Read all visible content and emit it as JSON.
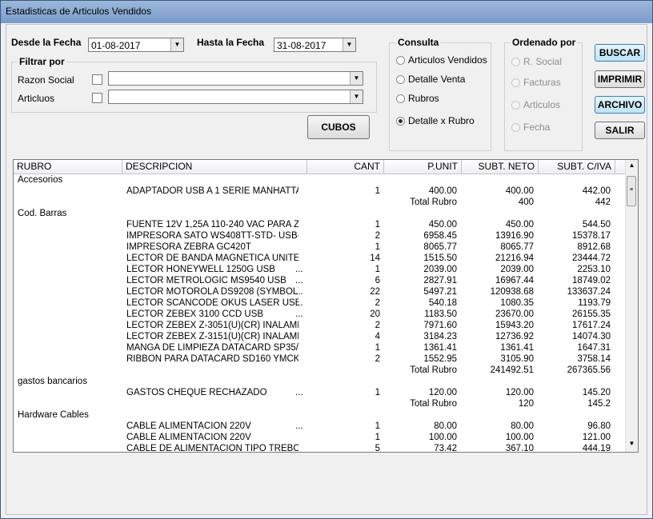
{
  "window": {
    "title": "Estadisticas de Articulos Vendidos"
  },
  "filters": {
    "desde_label": "Desde la Fecha",
    "desde_value": "01-08-2017",
    "hasta_label": "Hasta la Fecha",
    "hasta_value": "31-08-2017",
    "filtrar_por_label": "Filtrar por",
    "razon_social_label": "Razon Social",
    "articulos_label": "Articluos"
  },
  "consulta": {
    "label": "Consulta",
    "options": [
      "Articulos Vendidos",
      "Detalle Venta",
      "Rubros",
      "Detalle x Rubro"
    ],
    "selected": "Detalle x Rubro"
  },
  "ordenado": {
    "label": "Ordenado por",
    "options": [
      "R. Social",
      "Facturas",
      "Articulos",
      "Fecha"
    ]
  },
  "buttons": {
    "buscar": "BUSCAR",
    "imprimir": "IMPRIMIR",
    "archivo": "ARCHIVO",
    "salir": "SALIR",
    "cubos": "CUBOS"
  },
  "table": {
    "headers": [
      "RUBRO",
      "DESCRIPCION",
      "CANT",
      "P.UNIT",
      "SUBT. NETO",
      "SUBT. C/IVA"
    ],
    "rows": [
      [
        "Accesorios",
        "",
        "",
        "",
        "",
        "",
        ""
      ],
      [
        "",
        "ADAPTADOR USB A 1 SERIE MANHATTA...",
        "",
        "1",
        "400.00",
        "400.00",
        "442.00"
      ],
      [
        "",
        "",
        "",
        "",
        "Total Rubro",
        "400",
        "442"
      ],
      [
        "Cod. Barras",
        "",
        "",
        "",
        "",
        "",
        ""
      ],
      [
        "",
        "FUENTE 12V 1,25A 110-240 VAC  PARA Z...",
        "",
        "1",
        "450.00",
        "450.00",
        "544.50"
      ],
      [
        "",
        "IMPRESORA SATO WS408TT-STD- USB- ...",
        "",
        "2",
        "6958.45",
        "13916.90",
        "15378.17"
      ],
      [
        "",
        "IMPRESORA ZEBRA GC420T",
        "",
        "1",
        "8065.77",
        "8065.77",
        "8912.68"
      ],
      [
        "",
        "LECTOR DE BANDA MAGNETICA UNITEC...",
        "",
        "14",
        "1515.50",
        "21216.94",
        "23444.72"
      ],
      [
        "",
        "LECTOR HONEYWELL 1250G USB",
        "...",
        "1",
        "2039.00",
        "2039.00",
        "2253.10"
      ],
      [
        "",
        "LECTOR METROLOGIC MS9540 USB",
        "...",
        "6",
        "2827.91",
        "16967.44",
        "18749.02"
      ],
      [
        "",
        "LECTOR MOTOROLA DS9208  (SYMBOL)",
        "...",
        "22",
        "5497.21",
        "120938.68",
        "133637.24"
      ],
      [
        "",
        "LECTOR SCANCODE OKUS LASER USB",
        "...",
        "2",
        "540.18",
        "1080.35",
        "1193.79"
      ],
      [
        "",
        "LECTOR ZEBEX 3100 CCD USB",
        "...",
        "20",
        "1183.50",
        "23670.00",
        "26155.35"
      ],
      [
        "",
        "LECTOR ZEBEX Z-3051(U)(CR) INALAMBR...",
        "",
        "2",
        "7971.60",
        "15943.20",
        "17617.24"
      ],
      [
        "",
        "LECTOR ZEBEX Z-3151(U)(CR) INALAMBR...",
        "",
        "4",
        "3184.23",
        "12736.92",
        "14074.30"
      ],
      [
        "",
        "MANGA DE LIMPIEZA DATACARD SP35/S...",
        "",
        "1",
        "1361.41",
        "1361.41",
        "1647.31"
      ],
      [
        "",
        "RIBBON PARA DATACARD SD160  YMCK...",
        "",
        "2",
        "1552.95",
        "3105.90",
        "3758.14"
      ],
      [
        "",
        "",
        "",
        "",
        "Total Rubro",
        "241492.51",
        "267365.56"
      ],
      [
        "gastos bancarios",
        "",
        "",
        "",
        "",
        "",
        ""
      ],
      [
        "",
        "GASTOS CHEQUE RECHAZADO",
        "...",
        "1",
        "120.00",
        "120.00",
        "145.20"
      ],
      [
        "",
        "",
        "",
        "",
        "Total Rubro",
        "120",
        "145.2"
      ],
      [
        "Hardware  Cables",
        "",
        "",
        "",
        "",
        "",
        ""
      ],
      [
        "",
        "CABLE ALIMENTACION 220V",
        "...",
        "1",
        "80.00",
        "80.00",
        "96.80"
      ],
      [
        "",
        "CABLE ALIMENTACION 220V",
        "",
        "1",
        "100.00",
        "100.00",
        "121.00"
      ],
      [
        "",
        "CABLE DE ALIMENTACION TIPO TREBOL",
        "",
        "5",
        "73.42",
        "367.10",
        "444.19"
      ]
    ]
  },
  "icons": [
    "dropdown-arrow-icon",
    "scroll-up-icon",
    "scroll-down-icon",
    "mouse-cursor-icon"
  ]
}
